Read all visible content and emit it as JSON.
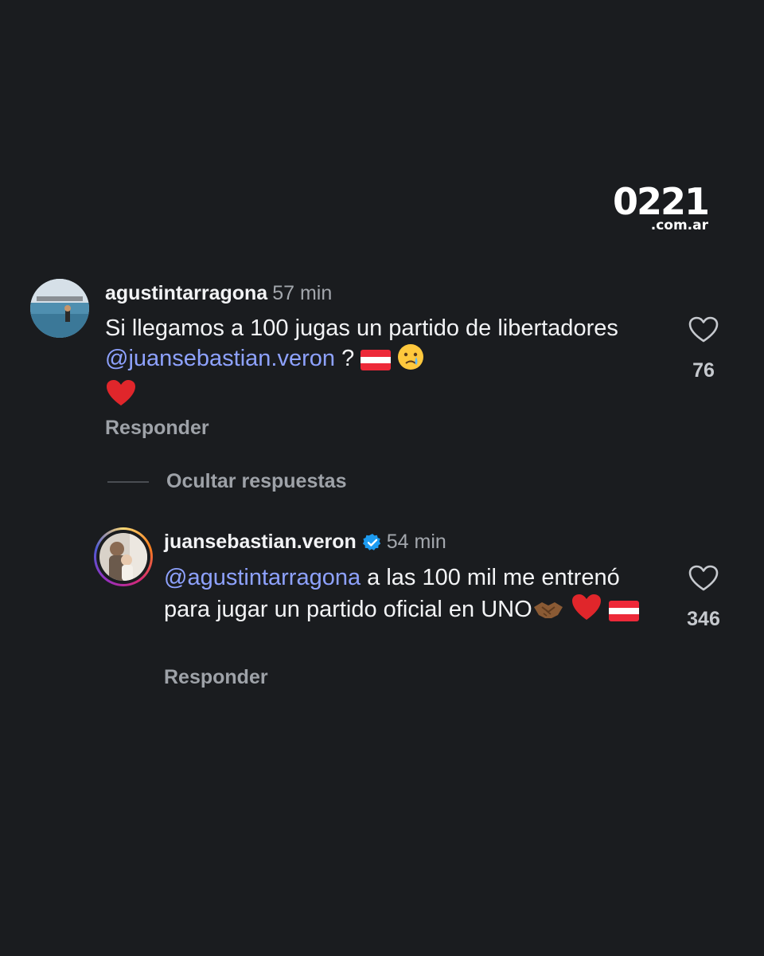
{
  "logo": {
    "main": "0221",
    "sub": ".com.ar"
  },
  "comment1": {
    "username": "agustintarragona",
    "time": "57 min",
    "text_part1": "Si llegamos a 100 jugas un partido de libertadores ",
    "mention": "@juansebastian.veron",
    "text_part2": " ? ",
    "likes": "76",
    "reply_label": "Responder"
  },
  "hide_replies": {
    "label": "Ocultar respuestas"
  },
  "comment2": {
    "username": "juansebastian.veron",
    "time": "54 min",
    "mention": "@agustintarragona",
    "text_part1": " a las 100 mil me entrenó para jugar un partido oficial en UNO",
    "likes": "346",
    "reply_label": "Responder"
  },
  "colors": {
    "background": "#1a1c1f",
    "mention": "#8ea2ff",
    "verified": "#1d9bf0"
  },
  "icons": [
    "heart-outline-icon",
    "verified-badge-icon",
    "austria-flag-emoji",
    "crying-face-emoji",
    "red-heart-emoji",
    "handshake-emoji"
  ]
}
